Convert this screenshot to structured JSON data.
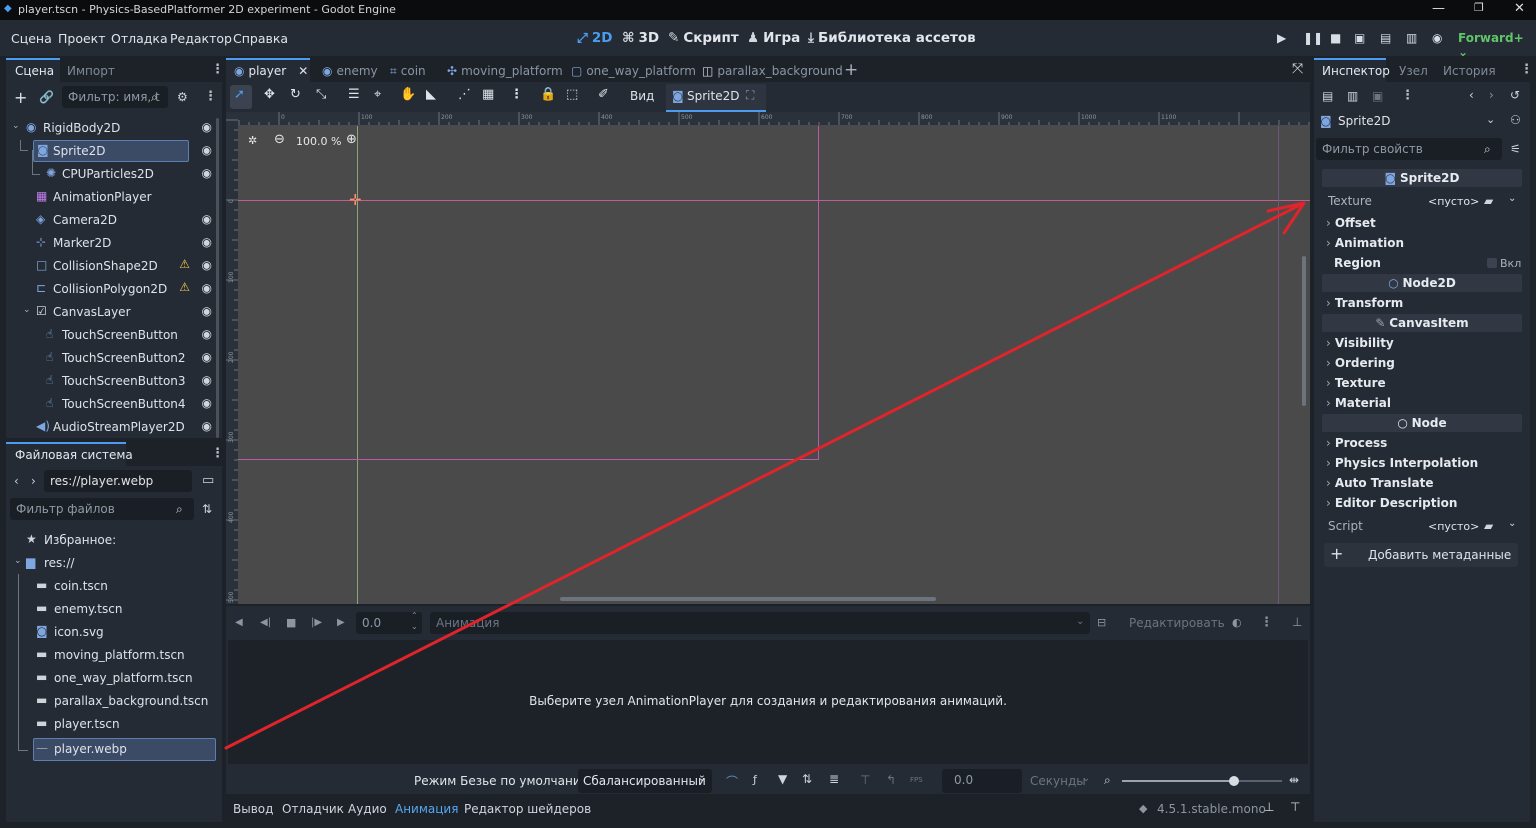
{
  "window": {
    "title": "player.tscn - Physics-BasedPlatformer 2D experiment - Godot Engine"
  },
  "menu": [
    "Сцена",
    "Проект",
    "Отладка",
    "Редактор",
    "Справка"
  ],
  "workspaces": [
    {
      "label": "2D",
      "icon": "2d-icon"
    },
    {
      "label": "3D",
      "icon": "3d-icon"
    },
    {
      "label": "Скрипт",
      "icon": "script-icon"
    },
    {
      "label": "Игра",
      "icon": "game-icon"
    },
    {
      "label": "Библиотека ассетов",
      "icon": "asset-library-icon"
    }
  ],
  "renderer": "Forward+",
  "scene_dock": {
    "tabs": [
      "Сцена",
      "Импорт"
    ],
    "filter_placeholder": "Фильтр: имя, t",
    "nodes": [
      {
        "label": "RigidBody2D",
        "icon": "rigidbody-icon",
        "eye": true
      },
      {
        "label": "Sprite2D",
        "icon": "sprite-icon",
        "eye": true,
        "selected": true
      },
      {
        "label": "CPUParticles2D",
        "icon": "particles-icon",
        "eye": true
      },
      {
        "label": "AnimationPlayer",
        "icon": "animation-player-icon",
        "eye": false
      },
      {
        "label": "Camera2D",
        "icon": "camera-icon",
        "eye": true
      },
      {
        "label": "Marker2D",
        "icon": "marker-icon",
        "eye": true
      },
      {
        "label": "CollisionShape2D",
        "icon": "collision-shape-icon",
        "eye": true,
        "warning": true
      },
      {
        "label": "CollisionPolygon2D",
        "icon": "collision-polygon-icon",
        "eye": true,
        "warning": true
      },
      {
        "label": "CanvasLayer",
        "icon": "canvas-layer-icon",
        "eye": true
      },
      {
        "label": "TouchScreenButton",
        "icon": "touch-button-icon",
        "eye": true
      },
      {
        "label": "TouchScreenButton2",
        "icon": "touch-button-icon",
        "eye": true
      },
      {
        "label": "TouchScreenButton3",
        "icon": "touch-button-icon",
        "eye": true
      },
      {
        "label": "TouchScreenButton4",
        "icon": "touch-button-icon",
        "eye": true
      },
      {
        "label": "AudioStreamPlayer2D",
        "icon": "audio-icon",
        "eye": true
      }
    ]
  },
  "filesystem": {
    "title": "Файловая система",
    "path": "res://player.webp",
    "filter_placeholder": "Фильтр файлов",
    "items": [
      {
        "label": "Избранное:",
        "icon": "star-icon"
      },
      {
        "label": "res://",
        "icon": "folder-icon"
      },
      {
        "label": "coin.tscn",
        "icon": "scene-file-icon"
      },
      {
        "label": "enemy.tscn",
        "icon": "scene-file-icon"
      },
      {
        "label": "icon.svg",
        "icon": "image-file-icon"
      },
      {
        "label": "moving_platform.tscn",
        "icon": "scene-file-icon"
      },
      {
        "label": "one_way_platform.tscn",
        "icon": "scene-file-icon"
      },
      {
        "label": "parallax_background.tscn",
        "icon": "scene-file-icon"
      },
      {
        "label": "player.tscn",
        "icon": "scene-file-icon"
      },
      {
        "label": "player.webp",
        "icon": "image-file-icon",
        "selected": true
      }
    ]
  },
  "editor_tabs": [
    "player",
    "enemy",
    "coin",
    "moving_platform",
    "one_way_platform",
    "parallax_background"
  ],
  "toolbar": {
    "view_label": "Вид",
    "selected_node": "Sprite2D"
  },
  "zoom": "100.0 %",
  "ruler_h": [
    "-100",
    "0",
    "100",
    "200",
    "300",
    "400",
    "500",
    "600",
    "700",
    "800",
    "900",
    "1000",
    "1100"
  ],
  "ruler_v": [
    "0",
    "100",
    "200",
    "300",
    "400",
    "500"
  ],
  "animation_panel": {
    "time": "0.0",
    "animation_placeholder": "Анимация",
    "edit_label": "Редактировать",
    "message": "Выберите узел AnimationPlayer для создания и редактирования анимаций.",
    "bezier_label": "Режим Безье по умолчанию:",
    "bezier_mode": "Сбалансированный",
    "fps_label": "FPS",
    "step_value": "0.0",
    "step_unit": "Секунды",
    "zoom_level": 0.7
  },
  "bottom_tabs": [
    "Вывод",
    "Отладчик",
    "Аудио",
    "Анимация",
    "Редактор шейдеров"
  ],
  "version": "4.5.1.stable.mono",
  "inspector": {
    "tabs": [
      "Инспектор",
      "Узел",
      "История"
    ],
    "node": "Sprite2D",
    "filter_placeholder": "Фильтр свойств",
    "sections": {
      "sprite2d": "Sprite2D",
      "node2d": "Node2D",
      "canvasitem": "CanvasItem",
      "node": "Node"
    },
    "texture_label": "Texture",
    "texture_value": "<пусто>",
    "sprite_props": [
      "Offset",
      "Animation"
    ],
    "region_label": "Region",
    "region_toggle": "Вкл",
    "node2d_props": [
      "Transform"
    ],
    "canvasitem_props": [
      "Visibility",
      "Ordering",
      "Texture",
      "Material"
    ],
    "node_props": [
      "Process",
      "Physics Interpolation",
      "Auto Translate",
      "Editor Description"
    ],
    "script_label": "Script",
    "script_value": "<пусто>",
    "add_meta": "Добавить метаданные"
  },
  "colors": {
    "accent": "#4a9df0",
    "annotation": "#e0242b",
    "warning": "#f2c94c"
  }
}
